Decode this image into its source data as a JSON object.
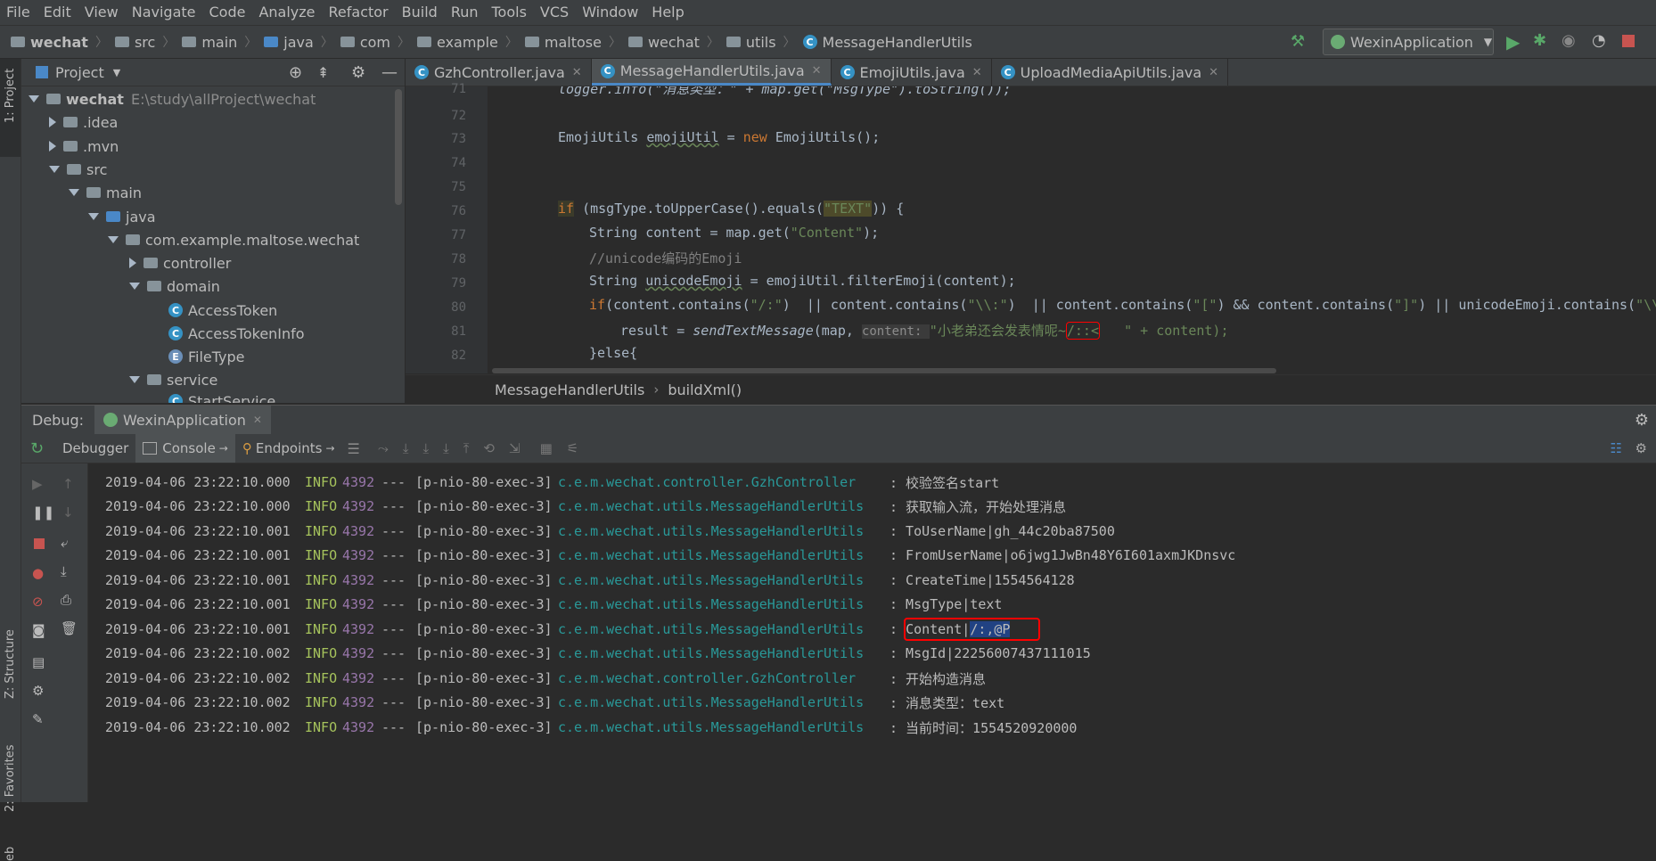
{
  "menu": [
    "File",
    "Edit",
    "View",
    "Navigate",
    "Code",
    "Analyze",
    "Refactor",
    "Build",
    "Run",
    "Tools",
    "VCS",
    "Window",
    "Help"
  ],
  "breadcrumb": [
    "wechat",
    "src",
    "main",
    "java",
    "com",
    "example",
    "maltose",
    "wechat",
    "utils",
    "MessageHandlerUtils"
  ],
  "run_config": "WexinApplication",
  "project": {
    "title": "Project",
    "tree": [
      {
        "label": "wechat",
        "extra": "E:\\study\\allProject\\wechat"
      },
      {
        "label": ".idea"
      },
      {
        "label": ".mvn"
      },
      {
        "label": "src"
      },
      {
        "label": "main"
      },
      {
        "label": "java"
      },
      {
        "label": "com.example.maltose.wechat"
      },
      {
        "label": "controller"
      },
      {
        "label": "domain"
      },
      {
        "label": "AccessToken"
      },
      {
        "label": "AccessTokenInfo"
      },
      {
        "label": "FileType"
      },
      {
        "label": "service"
      },
      {
        "label": "StartService"
      }
    ]
  },
  "left_strip": {
    "project": "1: Project",
    "structure": "Z: Structure",
    "favorites": "2: Favorites",
    "web": "eb"
  },
  "tabs": [
    "GzhController.java",
    "MessageHandlerUtils.java",
    "EmojiUtils.java",
    "UploadMediaApiUtils.java"
  ],
  "editor": {
    "line_numbers": [
      "71",
      "72",
      "73",
      "74",
      "75",
      "76",
      "77",
      "78",
      "79",
      "80",
      "81",
      "82"
    ],
    "lines": {
      "l71a": "logger.info(\"消息类型：\" + map.get(\"MsgType\").toString());",
      "l73a": "EmojiUtils ",
      "l73b": "emojiUtil",
      "l73c": " = ",
      "l73d": "new",
      "l73e": " EmojiUtils();",
      "l76a": "if",
      "l76b": " (msgType.toUpperCase().equals(",
      "l76c": "\"TEXT\"",
      "l76d": ")) {",
      "l77a": "String content = map.get(",
      "l77b": "\"Content\"",
      "l77c": ");",
      "l78a": "//unicode编码的Emoji",
      "l79a": "String ",
      "l79b": "unicodeEmoji",
      "l79c": " = emojiUtil.filterEmoji(content);",
      "l80a": "if",
      "l80b": "(content.contains(",
      "l80c": "\"/:\"",
      "l80d": ")  || content.contains(",
      "l80e": "\"\\\\:\"",
      "l80f": ")  || content.contains(",
      "l80g": "\"[\"",
      "l80h": ") && content.contains(",
      "l80i": "\"]\"",
      "l80j": ") || unicodeEmoji.contains(",
      "l80k": "\"\\\\",
      "l81a": "result = ",
      "l81b": "sendTextMessage",
      "l81c": "(map, ",
      "l81d": "content: ",
      "l81e": "\"小老弟还会发表情呢~",
      "l81f": "/::<",
      "l81g": "   \" + content);",
      "l82a": "}else{"
    },
    "footer": [
      "MessageHandlerUtils",
      "buildXml()"
    ]
  },
  "debug": {
    "label": "Debug:",
    "app": "WexinApplication",
    "tabs": [
      "Debugger",
      "Console",
      "Endpoints"
    ]
  },
  "log": [
    {
      "ts": "2019-04-06 23:22:10.000",
      "lv": "INFO",
      "pid": "4392",
      "sep": "---",
      "th": "[p-nio-80-exec-3]",
      "lg": "c.e.m.wechat.controller.GzhController",
      "msg": ": 校验签名start"
    },
    {
      "ts": "2019-04-06 23:22:10.000",
      "lv": "INFO",
      "pid": "4392",
      "sep": "---",
      "th": "[p-nio-80-exec-3]",
      "lg": "c.e.m.wechat.utils.MessageHandlerUtils",
      "msg": ": 获取输入流，开始处理消息"
    },
    {
      "ts": "2019-04-06 23:22:10.001",
      "lv": "INFO",
      "pid": "4392",
      "sep": "---",
      "th": "[p-nio-80-exec-3]",
      "lg": "c.e.m.wechat.utils.MessageHandlerUtils",
      "msg": ": ToUserName|gh_44c20ba87500"
    },
    {
      "ts": "2019-04-06 23:22:10.001",
      "lv": "INFO",
      "pid": "4392",
      "sep": "---",
      "th": "[p-nio-80-exec-3]",
      "lg": "c.e.m.wechat.utils.MessageHandlerUtils",
      "msg": ": FromUserName|o6jwg1JwBn48Y6I601axmJKDnsvc"
    },
    {
      "ts": "2019-04-06 23:22:10.001",
      "lv": "INFO",
      "pid": "4392",
      "sep": "---",
      "th": "[p-nio-80-exec-3]",
      "lg": "c.e.m.wechat.utils.MessageHandlerUtils",
      "msg": ": CreateTime|1554564128"
    },
    {
      "ts": "2019-04-06 23:22:10.001",
      "lv": "INFO",
      "pid": "4392",
      "sep": "---",
      "th": "[p-nio-80-exec-3]",
      "lg": "c.e.m.wechat.utils.MessageHandlerUtils",
      "msg": ": MsgType|text"
    },
    {
      "ts": "2019-04-06 23:22:10.001",
      "lv": "INFO",
      "pid": "4392",
      "sep": "---",
      "th": "[p-nio-80-exec-3]",
      "lg": "c.e.m.wechat.utils.MessageHandlerUtils",
      "msg_pre": ": ",
      "msg_box": "Content|",
      "msg_sel": "/:,@P"
    },
    {
      "ts": "2019-04-06 23:22:10.002",
      "lv": "INFO",
      "pid": "4392",
      "sep": "---",
      "th": "[p-nio-80-exec-3]",
      "lg": "c.e.m.wechat.utils.MessageHandlerUtils",
      "msg": ": MsgId|22256007437111015"
    },
    {
      "ts": "2019-04-06 23:22:10.002",
      "lv": "INFO",
      "pid": "4392",
      "sep": "---",
      "th": "[p-nio-80-exec-3]",
      "lg": "c.e.m.wechat.controller.GzhController",
      "msg": ": 开始构造消息"
    },
    {
      "ts": "2019-04-06 23:22:10.002",
      "lv": "INFO",
      "pid": "4392",
      "sep": "---",
      "th": "[p-nio-80-exec-3]",
      "lg": "c.e.m.wechat.utils.MessageHandlerUtils",
      "msg": ": 消息类型：text"
    },
    {
      "ts": "2019-04-06 23:22:10.002",
      "lv": "INFO",
      "pid": "4392",
      "sep": "---",
      "th": "[p-nio-80-exec-3]",
      "lg": "c.e.m.wechat.utils.MessageHandlerUtils",
      "msg": ": 当前时间：1554520920000"
    }
  ],
  "colors": {
    "accent": "#4a88c7",
    "highlight_box": "#ff0000",
    "selection": "#214283"
  }
}
